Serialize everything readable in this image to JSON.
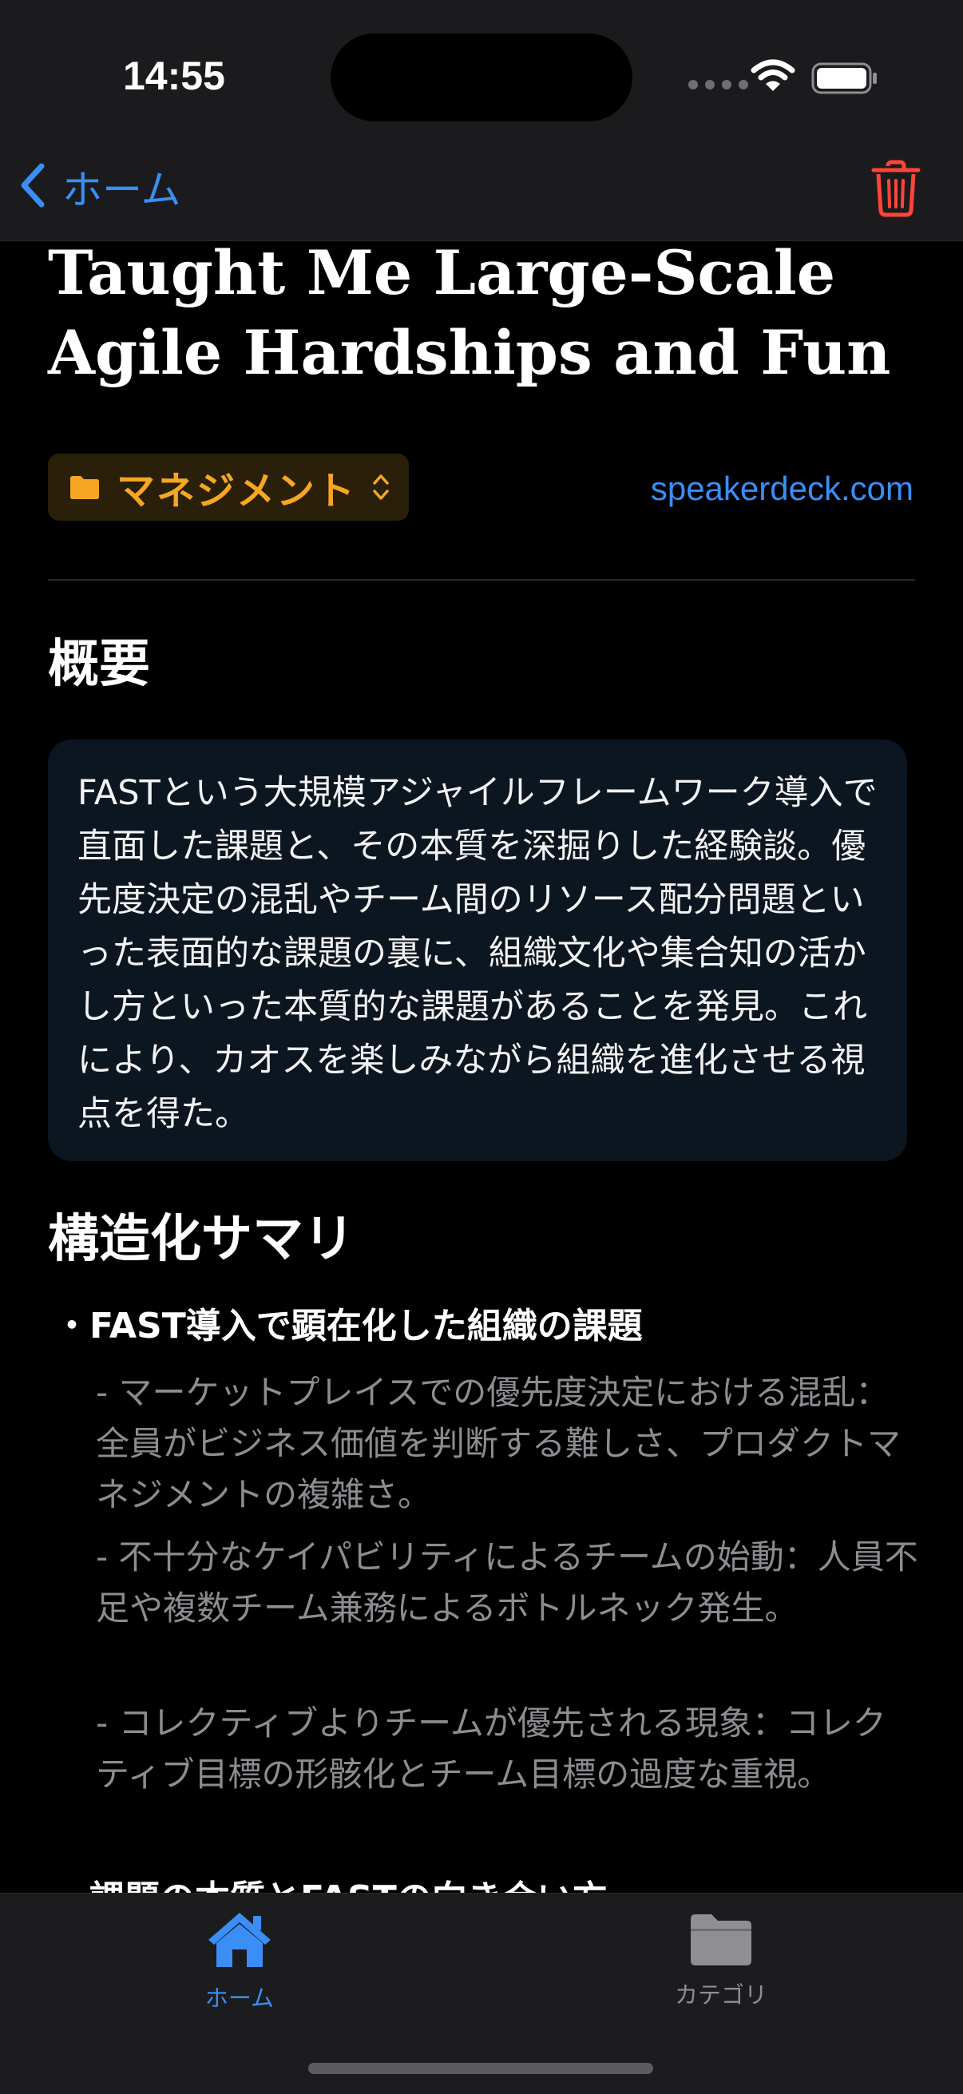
{
  "status_bar": {
    "time": "14:55"
  },
  "nav": {
    "back_label": "ホーム"
  },
  "article": {
    "title": "Taught Me Large-Scale Agile Hardships and Fun",
    "category": "マネジメント",
    "source": "speakerdeck.com"
  },
  "overview": {
    "heading": "概要",
    "text": "FASTという大規模アジャイルフレームワーク導入で直面した課題と、その本質を深掘りした経験談。優先度決定の混乱やチーム間のリソース配分問題といった表面的な課題の裏に、組織文化や集合知の活かし方といった本質的な課題があることを発見。これにより、カオスを楽しみながら組織を進化させる視点を得た。"
  },
  "structured": {
    "heading": "構造化サマリ",
    "bullets": [
      {
        "title": "・FAST導入で顕在化した組織の課題",
        "items": [
          "- マーケットプレイスでの優先度決定における混乱：全員がビジネス価値を判断する難しさ、プロダクトマネジメントの複雑さ。",
          "- 不十分なケイパビリティによるチームの始動：人員不足や複数チーム兼務によるボトルネック発生。",
          "- コレクティブよりチームが優先される現象：コレクティブ目標の形骸化とチーム目標の過度な重視。"
        ]
      },
      {
        "title": "・課題の本質とFASTの向き合い方"
      }
    ]
  },
  "tabbar": {
    "home": "ホーム",
    "category": "カテゴリ"
  },
  "colors": {
    "accent": "#3a8ef6",
    "category_orange": "#f5a623",
    "delete_red": "#ff453a"
  }
}
